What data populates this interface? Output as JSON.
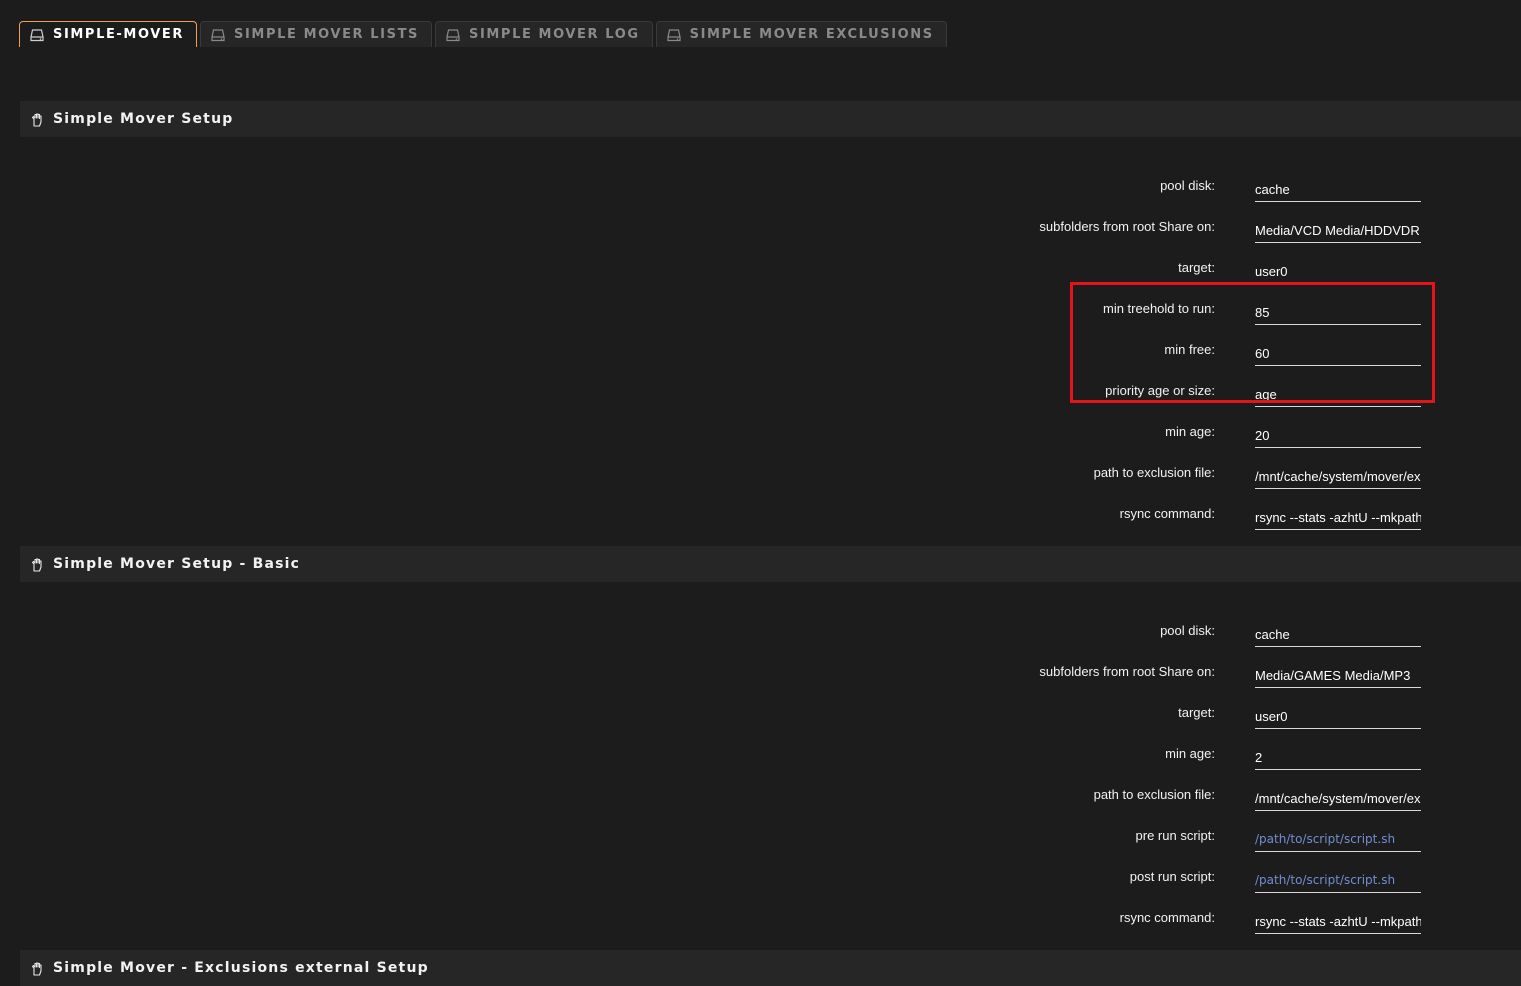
{
  "tabs": [
    {
      "label": "SIMPLE-MOVER",
      "icon": "drive-icon",
      "active": true
    },
    {
      "label": "SIMPLE MOVER LISTS",
      "icon": "drive-icon",
      "active": false
    },
    {
      "label": "SIMPLE MOVER LOG",
      "icon": "drive-icon",
      "active": false
    },
    {
      "label": "SIMPLE MOVER EXCLUSIONS",
      "icon": "drive-icon",
      "active": false
    }
  ],
  "sections": [
    {
      "title": "Simple Mover Setup",
      "icon": "hand-icon",
      "fields": [
        {
          "label": "pool disk:",
          "value": "cache"
        },
        {
          "label": "subfolders from root Share on:",
          "value": "Media/VCD Media/HDDVDR Media/Movies"
        },
        {
          "label": "target:",
          "value": "user0"
        },
        {
          "label": "min treehold to run:",
          "value": "85"
        },
        {
          "label": "min free:",
          "value": "60"
        },
        {
          "label": "priority age or size:",
          "value": "age"
        },
        {
          "label": "min age:",
          "value": "20"
        },
        {
          "label": "path to exclusion file:",
          "value": "/mnt/cache/system/mover/exclusions.txt"
        },
        {
          "label": "rsync command:",
          "value": "rsync --stats -azhtU --mkpath"
        }
      ]
    },
    {
      "title": "Simple Mover Setup - Basic",
      "icon": "hand-icon",
      "fields": [
        {
          "label": "pool disk:",
          "value": "cache"
        },
        {
          "label": "subfolders from root Share on:",
          "value": "Media/GAMES Media/MP3"
        },
        {
          "label": "target:",
          "value": "user0"
        },
        {
          "label": "min age:",
          "value": "2"
        },
        {
          "label": "path to exclusion file:",
          "value": "/mnt/cache/system/mover/exclusions.txt"
        },
        {
          "label": "pre run script:",
          "value": "",
          "placeholder": "/path/to/script/script.sh"
        },
        {
          "label": "post run script:",
          "value": "",
          "placeholder": "/path/to/script/script.sh"
        },
        {
          "label": "rsync command:",
          "value": "rsync --stats -azhtU --mkpath"
        }
      ]
    },
    {
      "title": "Simple Mover - Exclusions external Setup",
      "icon": "hand-icon",
      "fields": []
    }
  ],
  "highlight_color": "#e5141b",
  "accent_color": "#f0a04b",
  "placeholder_color": "#6f8fd2"
}
